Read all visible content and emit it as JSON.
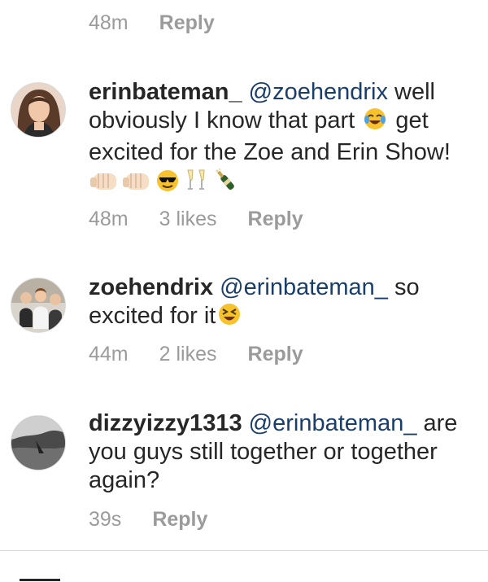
{
  "comments": [
    {
      "time": "48m",
      "likes": "",
      "reply": "Reply"
    },
    {
      "username": "erinbateman_",
      "mention": "@zoehendrix",
      "text_1": " well obviously I know that part ",
      "text_2": " get excited for the Zoe and Erin Show! ",
      "emojis": [
        "tears-of-joy-emoji",
        "fist-bump-emoji",
        "fist-bump-emoji",
        "sunglasses-emoji",
        "champagne-glasses-emoji",
        "champagne-bottle-emoji"
      ],
      "time": "48m",
      "likes": "3 likes",
      "reply": "Reply"
    },
    {
      "username": "zoehendrix",
      "mention": "@erinbateman_",
      "text_1": " so excited for it",
      "emojis": [
        "laughing-squint-emoji"
      ],
      "time": "44m",
      "likes": "2 likes",
      "reply": "Reply"
    },
    {
      "username": "dizzyizzy1313",
      "mention": "@erinbateman_",
      "text_1": " are you guys still together or together again?",
      "time": "39s",
      "likes": "",
      "reply": "Reply"
    }
  ]
}
